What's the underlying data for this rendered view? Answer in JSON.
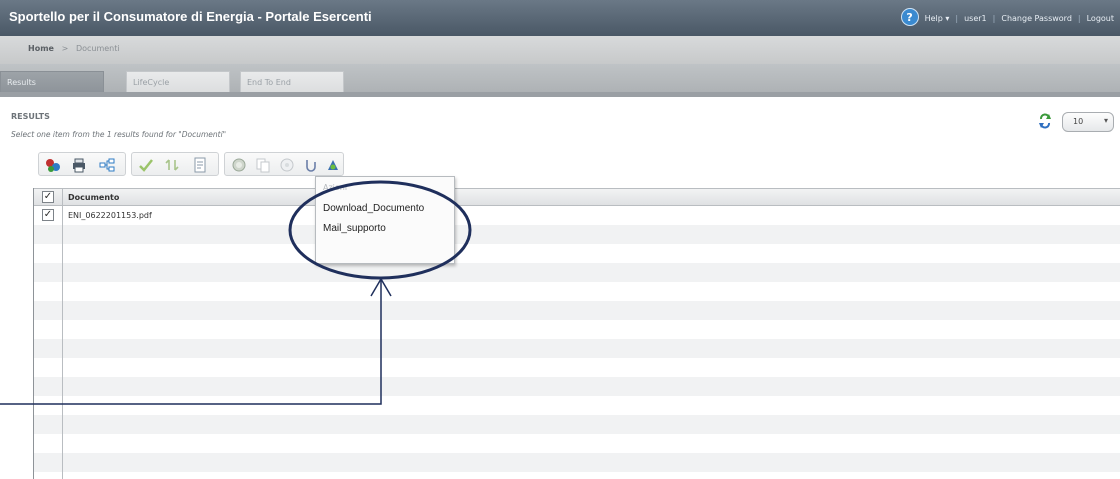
{
  "header": {
    "title": "Sportello per il Consumatore di Energia - Portale Esercenti",
    "help_label": "Help ▾",
    "user": "user1",
    "change_password": "Change Password",
    "logout": "Logout"
  },
  "breadcrumb": {
    "home": "Home",
    "separator": ">",
    "current": "Documenti"
  },
  "tabs": [
    {
      "label": "Results"
    },
    {
      "label": "LifeCycle"
    },
    {
      "label": "End To End"
    }
  ],
  "results": {
    "heading": "RESULTS",
    "subtitle": "Select one item from the 1 results found for \"Documenti\"",
    "page_size": "10"
  },
  "grid": {
    "column": "Documento",
    "rows": [
      {
        "name": "ENI_0622201153.pdf"
      }
    ]
  },
  "menu": {
    "title": "Azioni",
    "items": [
      "Download_Documento",
      "Mail_supporto"
    ]
  },
  "colors": {
    "header": "#4a5866",
    "annotation": "#1f2f5c",
    "accent": "#3a8ad0"
  }
}
